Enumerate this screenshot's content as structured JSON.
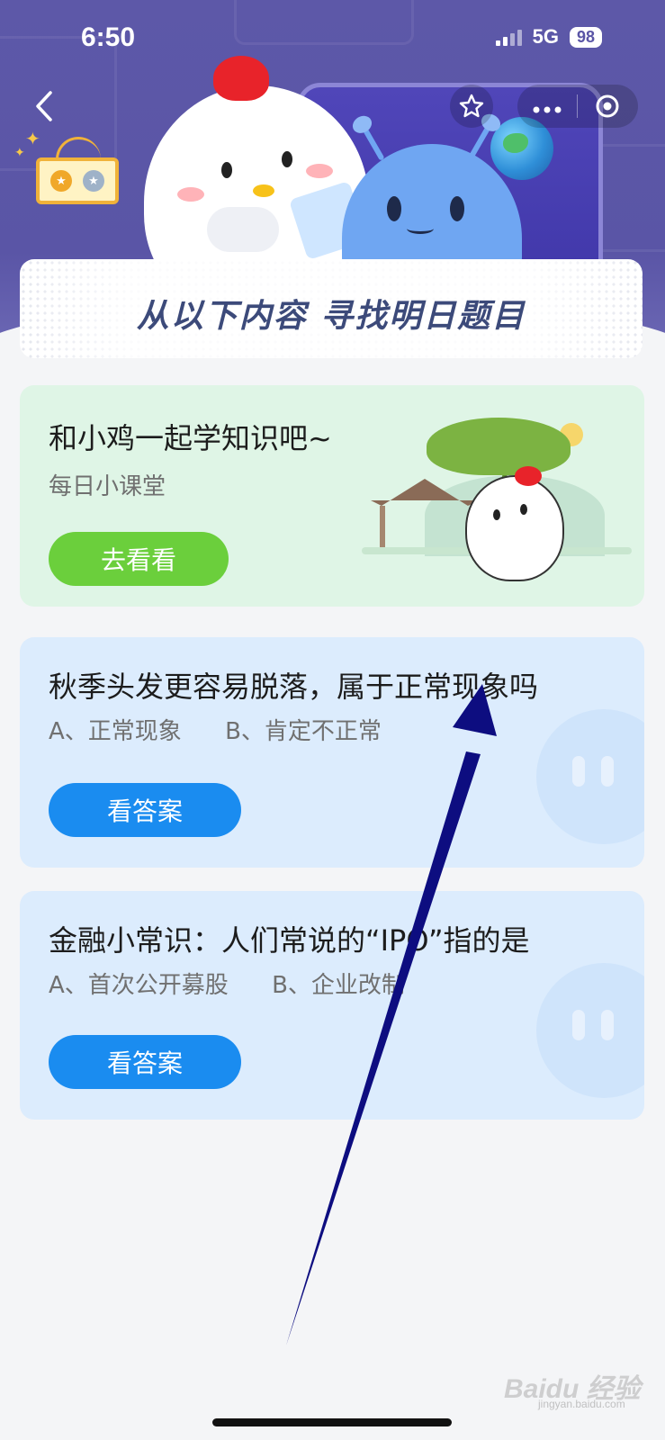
{
  "status_bar": {
    "time": "6:50",
    "network": "5G",
    "battery": "98"
  },
  "header": {
    "headline": "从以下内容 寻找明日题目"
  },
  "cards": [
    {
      "title": "和小鸡一起学知识吧~",
      "subtitle": "每日小课堂",
      "button": "去看看"
    },
    {
      "title": "秋季头发更容易脱落，属于正常现象吗",
      "option_a": "A、正常现象",
      "option_b": "B、肯定不正常",
      "button": "看答案"
    },
    {
      "title": "金融小常识：人们常说的“IPO”指的是",
      "option_a": "A、首次公开募股",
      "option_b": "B、企业改制",
      "button": "看答案"
    }
  ],
  "watermark": {
    "brand": "Baidu 经验",
    "domain": "jingyan.baidu.com"
  },
  "icons": {
    "back": "chevron-left-icon",
    "favorite": "star-icon",
    "more": "more-dots-icon",
    "close": "target-circle-icon"
  },
  "colors": {
    "header_bg": "#5a55a6",
    "green_card": "#dff5e6",
    "blue_card": "#dcecfd",
    "green_button": "#6bcf3c",
    "blue_button": "#1a8cf0",
    "arrow": "#0d0d80"
  }
}
